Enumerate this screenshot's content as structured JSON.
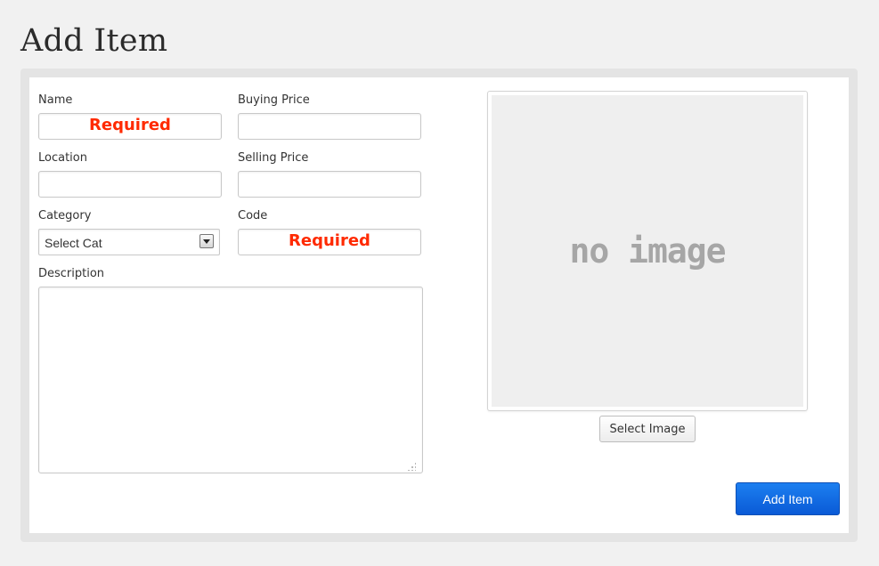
{
  "page": {
    "title": "Add Item"
  },
  "form": {
    "name": {
      "label": "Name",
      "placeholder": "Required",
      "value": ""
    },
    "buying_price": {
      "label": "Buying Price",
      "value": ""
    },
    "location": {
      "label": "Location",
      "value": ""
    },
    "selling_price": {
      "label": "Selling Price",
      "value": ""
    },
    "category": {
      "label": "Category",
      "selected": "Select Cat"
    },
    "code": {
      "label": "Code",
      "placeholder": "Required",
      "value": ""
    },
    "description": {
      "label": "Description",
      "value": ""
    }
  },
  "image": {
    "placeholder_text": "no image",
    "select_label": "Select Image"
  },
  "actions": {
    "submit_label": "Add Item"
  },
  "colors": {
    "required_text": "#ff2a00",
    "primary_button": "#0a5ad6",
    "panel_border": "#e4e4e4"
  }
}
